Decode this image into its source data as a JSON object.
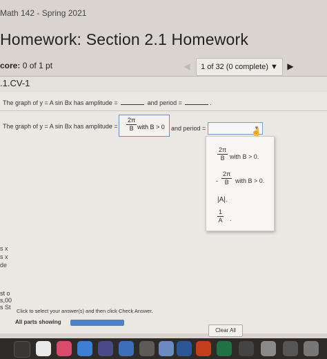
{
  "header": {
    "course": "Math 142 - Spring 2021",
    "title": "Homework: Section 2.1 Homework",
    "score_label": "core:",
    "score_value": "0 of 1 pt",
    "nav_prev": "◀",
    "nav_progress": "1 of 32 (0 complete) ▼",
    "nav_next": "▶",
    "question_id": ".1.CV-1"
  },
  "question": {
    "stem_prefix": "The graph of y = A sin Bx has amplitude = ",
    "stem_mid": " and period = ",
    "stem_end": ".",
    "answer_prefix": "The graph of y = A sin Bx has amplitude = ",
    "amplitude_num": "2π",
    "amplitude_den": "B",
    "amplitude_cond": "with B > 0",
    "period_label": "and period =",
    "period_arrow": "▼"
  },
  "dropdown": {
    "options": [
      {
        "num": "2π",
        "den": "B",
        "cond": "with B > 0."
      },
      {
        "neg": "-",
        "num": "2π",
        "den": "B",
        "cond": "with B > 0."
      },
      {
        "text": "|A|."
      },
      {
        "num": "1",
        "den": "A",
        "cond": "."
      }
    ]
  },
  "footer": {
    "instructions": "Click to select your answer(s) and then click Check Answer.",
    "parts": "All parts showing",
    "clear_all": "Clear All",
    "left_fragments": [
      "st o",
      "s,00",
      "s St"
    ]
  },
  "sidebar_fragments": [
    "s x",
    "s x",
    "de"
  ],
  "colors": {
    "accent": "#4d82c9",
    "select_border": "#7d9cc4",
    "background": "#ebe8e4"
  }
}
